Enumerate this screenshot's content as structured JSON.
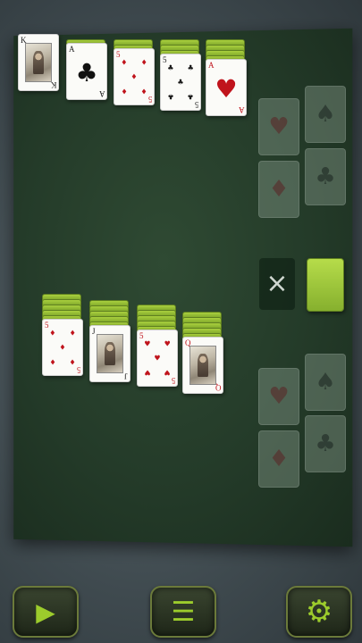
{
  "top_row": [
    {
      "rank": "K",
      "suit": "♣",
      "color": "black",
      "face": true,
      "backs": 0
    },
    {
      "rank": "A",
      "suit": "♣",
      "color": "black",
      "face": false,
      "backs": 1
    },
    {
      "rank": "5",
      "suit": "♦",
      "color": "red",
      "face": false,
      "backs": 2
    },
    {
      "rank": "5",
      "suit": "♣",
      "color": "black",
      "face": false,
      "backs": 3
    },
    {
      "rank": "A",
      "suit": "♥",
      "color": "red",
      "face": false,
      "backs": 4
    }
  ],
  "bottom_row": [
    {
      "rank": "5",
      "suit": "♦",
      "color": "red",
      "face": false,
      "backs": 5
    },
    {
      "rank": "J",
      "suit": "♠",
      "color": "black",
      "face": true,
      "backs": 5
    },
    {
      "rank": "5",
      "suit": "♥",
      "color": "red",
      "face": false,
      "backs": 5
    },
    {
      "rank": "Q",
      "suit": "♦",
      "color": "red",
      "face": true,
      "backs": 5
    }
  ],
  "foundations_top": [
    "♥",
    "♠",
    "♦",
    "♣"
  ],
  "foundations_bottom": [
    "♥",
    "♠",
    "♦",
    "♣"
  ],
  "discard_icon": "×",
  "toolbar": {
    "play_icon": "▶",
    "menu_icon": "☰",
    "settings_icon": "⚙"
  },
  "colors": {
    "card_back": "#9cc63a",
    "felt": "#243b29",
    "accent": "#9ccc2c"
  }
}
